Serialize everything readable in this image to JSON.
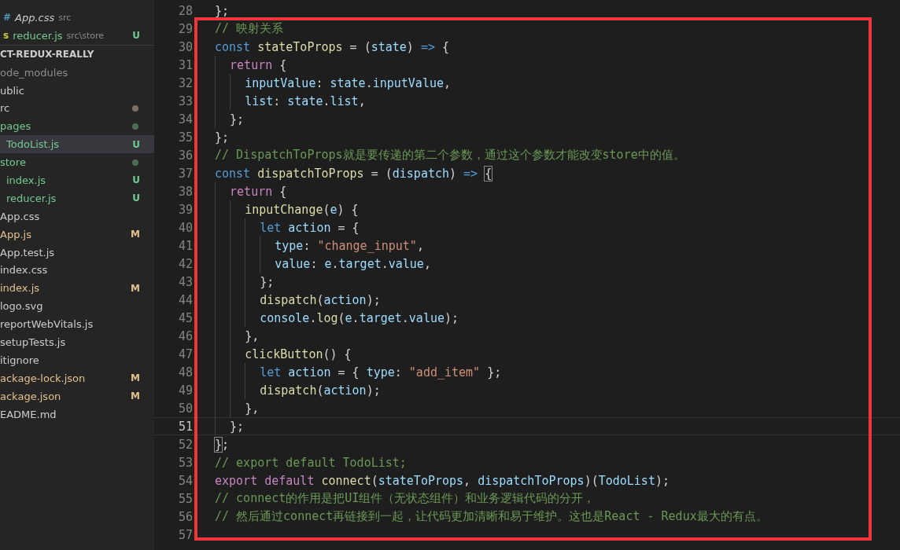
{
  "sidebar": {
    "open_editors": [
      {
        "icon": {
          "glyph": "#",
          "color": "#519aba"
        },
        "name": "App.css",
        "path": "src",
        "color": "#cccccc",
        "italic": true
      },
      {
        "icon": {
          "glyph": "s",
          "color": "#cbcb41"
        },
        "name": "reducer.js",
        "path": "src\\store",
        "badge": "U",
        "color": "#73c991",
        "italic": false
      }
    ],
    "project_title": "CT-REDUX-REALLY",
    "tree": [
      {
        "name": "ode_modules",
        "kind": "ignored",
        "selected": false
      },
      {
        "name": "ublic",
        "kind": "normal",
        "selected": false
      },
      {
        "name": "rc",
        "kind": "normal",
        "selected": false,
        "color": "#7b7068",
        "children": [
          {
            "name": "pages",
            "kind": "untracked",
            "selected": false,
            "color": "#4b6b58",
            "children": [
              {
                "name": "TodoList.js",
                "kind": "untracked",
                "badge": "U",
                "selected": true
              }
            ]
          },
          {
            "name": "store",
            "kind": "untracked",
            "selected": false,
            "color": "#4b6b58",
            "children": [
              {
                "name": "index.js",
                "kind": "untracked",
                "badge": "U",
                "selected": false
              },
              {
                "name": "reducer.js",
                "kind": "untracked",
                "badge": "U",
                "selected": false
              }
            ]
          },
          {
            "name": "App.css",
            "kind": "normal",
            "selected": false
          },
          {
            "name": "App.js",
            "kind": "modified",
            "badge": "M",
            "selected": false
          },
          {
            "name": "App.test.js",
            "kind": "normal",
            "selected": false
          },
          {
            "name": "index.css",
            "kind": "normal",
            "selected": false
          },
          {
            "name": "index.js",
            "kind": "modified",
            "badge": "M",
            "selected": false
          },
          {
            "name": "logo.svg",
            "kind": "normal",
            "selected": false
          },
          {
            "name": "reportWebVitals.js",
            "kind": "normal",
            "selected": false
          },
          {
            "name": "setupTests.js",
            "kind": "normal",
            "selected": false
          }
        ]
      },
      {
        "name": "itignore",
        "kind": "normal",
        "selected": false
      },
      {
        "name": "ackage-lock.json",
        "kind": "modified",
        "badge": "M",
        "selected": false
      },
      {
        "name": "ackage.json",
        "kind": "modified",
        "badge": "M",
        "selected": false
      },
      {
        "name": "EADME.md",
        "kind": "normal",
        "selected": false
      }
    ]
  },
  "editor": {
    "lines": [
      {
        "n": "28",
        "current": false,
        "tokens": [
          {
            "kind": "p",
            "text": "};"
          }
        ]
      },
      {
        "n": "29",
        "current": false,
        "tokens": [
          {
            "kind": "c",
            "text": "// 映射关系"
          }
        ]
      },
      {
        "n": "30",
        "current": false,
        "tokens": [
          {
            "kind": "kw",
            "text": "const "
          },
          {
            "kind": "fn",
            "text": "stateToProps"
          },
          {
            "kind": "p",
            "text": " = ("
          },
          {
            "kind": "v",
            "text": "state"
          },
          {
            "kind": "p",
            "text": ") "
          },
          {
            "kind": "kw",
            "text": "=>"
          },
          {
            "kind": "p",
            "text": " {"
          }
        ]
      },
      {
        "n": "31",
        "current": false,
        "tokens": [
          {
            "kind": "ctl",
            "text": "  return"
          },
          {
            "kind": "p",
            "text": " {"
          }
        ]
      },
      {
        "n": "32",
        "current": false,
        "tokens": [
          {
            "kind": "v",
            "text": "    inputValue"
          },
          {
            "kind": "p",
            "text": ": "
          },
          {
            "kind": "v",
            "text": "state"
          },
          {
            "kind": "p",
            "text": "."
          },
          {
            "kind": "v",
            "text": "inputValue"
          },
          {
            "kind": "p",
            "text": ","
          }
        ]
      },
      {
        "n": "33",
        "current": false,
        "tokens": [
          {
            "kind": "v",
            "text": "    list"
          },
          {
            "kind": "p",
            "text": ": "
          },
          {
            "kind": "v",
            "text": "state"
          },
          {
            "kind": "p",
            "text": "."
          },
          {
            "kind": "v",
            "text": "list"
          },
          {
            "kind": "p",
            "text": ","
          }
        ]
      },
      {
        "n": "34",
        "current": false,
        "tokens": [
          {
            "kind": "p",
            "text": "  };"
          }
        ]
      },
      {
        "n": "35",
        "current": false,
        "tokens": [
          {
            "kind": "p",
            "text": "};"
          }
        ]
      },
      {
        "n": "36",
        "current": false,
        "tokens": [
          {
            "kind": "c",
            "text": "// DispatchToProps就是要传递的第二个参数，通过这个参数才能改变store中的值。"
          }
        ]
      },
      {
        "n": "37",
        "current": false,
        "tokens": [
          {
            "kind": "kw",
            "text": "const "
          },
          {
            "kind": "fn",
            "text": "dispatchToProps"
          },
          {
            "kind": "p",
            "text": " = ("
          },
          {
            "kind": "v",
            "text": "dispatch"
          },
          {
            "kind": "p",
            "text": ") "
          },
          {
            "kind": "kw",
            "text": "=> "
          },
          {
            "kind": "bm",
            "text": "{"
          }
        ]
      },
      {
        "n": "38",
        "current": false,
        "tokens": [
          {
            "kind": "ctl",
            "text": "  return"
          },
          {
            "kind": "p",
            "text": " {"
          }
        ]
      },
      {
        "n": "39",
        "current": false,
        "tokens": [
          {
            "kind": "fn",
            "text": "    inputChange"
          },
          {
            "kind": "p",
            "text": "("
          },
          {
            "kind": "v",
            "text": "e"
          },
          {
            "kind": "p",
            "text": ") {"
          }
        ]
      },
      {
        "n": "40",
        "current": false,
        "tokens": [
          {
            "kind": "kw",
            "text": "      let "
          },
          {
            "kind": "v",
            "text": "action"
          },
          {
            "kind": "p",
            "text": " = {"
          }
        ]
      },
      {
        "n": "41",
        "current": false,
        "tokens": [
          {
            "kind": "v",
            "text": "        type"
          },
          {
            "kind": "p",
            "text": ": "
          },
          {
            "kind": "s",
            "text": "\"change_input\""
          },
          {
            "kind": "p",
            "text": ","
          }
        ]
      },
      {
        "n": "42",
        "current": false,
        "tokens": [
          {
            "kind": "v",
            "text": "        value"
          },
          {
            "kind": "p",
            "text": ": "
          },
          {
            "kind": "v",
            "text": "e"
          },
          {
            "kind": "p",
            "text": "."
          },
          {
            "kind": "v",
            "text": "target"
          },
          {
            "kind": "p",
            "text": "."
          },
          {
            "kind": "v",
            "text": "value"
          },
          {
            "kind": "p",
            "text": ","
          }
        ]
      },
      {
        "n": "43",
        "current": false,
        "tokens": [
          {
            "kind": "p",
            "text": "      };"
          }
        ]
      },
      {
        "n": "44",
        "current": false,
        "tokens": [
          {
            "kind": "fn",
            "text": "      dispatch"
          },
          {
            "kind": "p",
            "text": "("
          },
          {
            "kind": "v",
            "text": "action"
          },
          {
            "kind": "p",
            "text": ");"
          }
        ]
      },
      {
        "n": "45",
        "current": false,
        "tokens": [
          {
            "kind": "v",
            "text": "      console"
          },
          {
            "kind": "p",
            "text": "."
          },
          {
            "kind": "fn",
            "text": "log"
          },
          {
            "kind": "p",
            "text": "("
          },
          {
            "kind": "v",
            "text": "e"
          },
          {
            "kind": "p",
            "text": "."
          },
          {
            "kind": "v",
            "text": "target"
          },
          {
            "kind": "p",
            "text": "."
          },
          {
            "kind": "v",
            "text": "value"
          },
          {
            "kind": "p",
            "text": ");"
          }
        ]
      },
      {
        "n": "46",
        "current": false,
        "tokens": [
          {
            "kind": "p",
            "text": "    },"
          }
        ]
      },
      {
        "n": "47",
        "current": false,
        "tokens": [
          {
            "kind": "fn",
            "text": "    clickButton"
          },
          {
            "kind": "p",
            "text": "() {"
          }
        ]
      },
      {
        "n": "48",
        "current": false,
        "tokens": [
          {
            "kind": "kw",
            "text": "      let "
          },
          {
            "kind": "v",
            "text": "action"
          },
          {
            "kind": "p",
            "text": " = { "
          },
          {
            "kind": "v",
            "text": "type"
          },
          {
            "kind": "p",
            "text": ": "
          },
          {
            "kind": "s",
            "text": "\"add_item\""
          },
          {
            "kind": "p",
            "text": " };"
          }
        ]
      },
      {
        "n": "49",
        "current": false,
        "tokens": [
          {
            "kind": "fn",
            "text": "      dispatch"
          },
          {
            "kind": "p",
            "text": "("
          },
          {
            "kind": "v",
            "text": "action"
          },
          {
            "kind": "p",
            "text": ");"
          }
        ]
      },
      {
        "n": "50",
        "current": false,
        "tokens": [
          {
            "kind": "p",
            "text": "    },"
          }
        ]
      },
      {
        "n": "51",
        "current": true,
        "tokens": [
          {
            "kind": "p",
            "text": "  };"
          }
        ]
      },
      {
        "n": "52",
        "current": false,
        "tokens": [
          {
            "kind": "bm",
            "text": "}"
          },
          {
            "kind": "p",
            "text": ";"
          }
        ]
      },
      {
        "n": "53",
        "current": false,
        "tokens": [
          {
            "kind": "c",
            "text": "// export default TodoList;"
          }
        ]
      },
      {
        "n": "54",
        "current": false,
        "tokens": [
          {
            "kind": "ctl",
            "text": "export "
          },
          {
            "kind": "ctl",
            "text": "default "
          },
          {
            "kind": "fn",
            "text": "connect"
          },
          {
            "kind": "p",
            "text": "("
          },
          {
            "kind": "v",
            "text": "stateToProps"
          },
          {
            "kind": "p",
            "text": ", "
          },
          {
            "kind": "v",
            "text": "dispatchToProps"
          },
          {
            "kind": "p",
            "text": ")("
          },
          {
            "kind": "v",
            "text": "TodoList"
          },
          {
            "kind": "p",
            "text": ");"
          }
        ]
      },
      {
        "n": "55",
        "current": false,
        "tokens": [
          {
            "kind": "c",
            "text": "// connect的作用是把UI组件（无状态组件）和业务逻辑代码的分开，"
          }
        ]
      },
      {
        "n": "56",
        "current": false,
        "tokens": [
          {
            "kind": "c",
            "text": "// 然后通过connect再链接到一起，让代码更加清晰和易于维护。这也是React - Redux最大的有点。"
          }
        ]
      },
      {
        "n": "57",
        "current": false
      }
    ]
  }
}
